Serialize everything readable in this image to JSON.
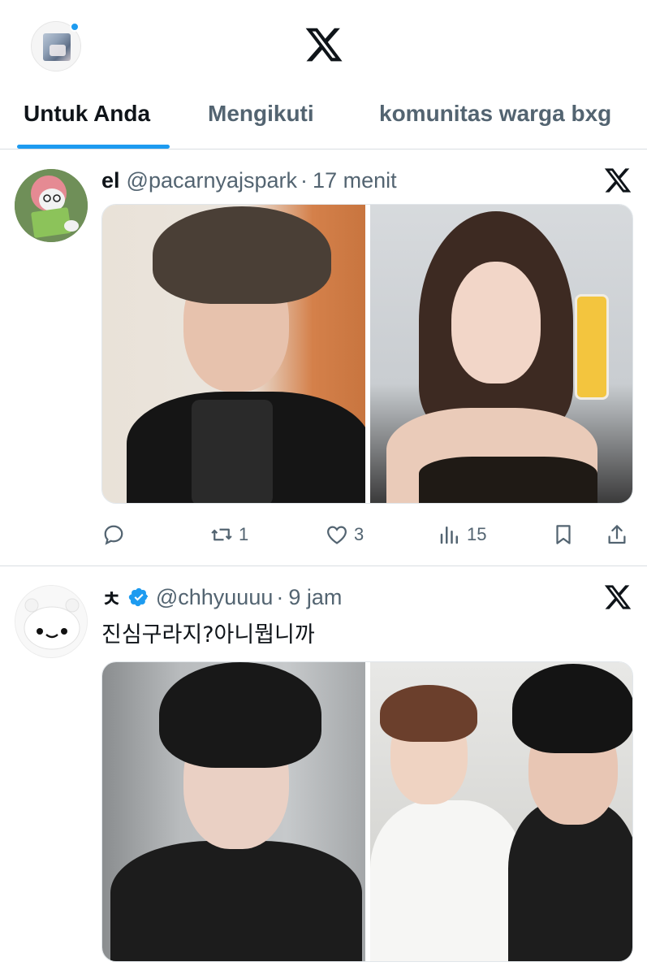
{
  "header": {
    "logo_icon": "x-logo-icon",
    "profile_icon": "profile-avatar",
    "notification_dot_color": "#1d9bf0"
  },
  "tabs": [
    {
      "label": "Untuk Anda",
      "active": true
    },
    {
      "label": "Mengikuti",
      "active": false
    },
    {
      "label": "komunitas warga bxg",
      "active": false
    }
  ],
  "accent_color": "#1d9bf0",
  "tweets": [
    {
      "name": "el",
      "handle": "@pacarnyajspark",
      "separator": "·",
      "time": "17 menit",
      "verified": false,
      "text": "",
      "media_count": 2,
      "actions": {
        "reply": "",
        "retweet": "1",
        "like": "3",
        "views": "15"
      }
    },
    {
      "name": "ㅊ",
      "handle": "@chhyuuuu",
      "separator": "·",
      "time": "9 jam",
      "verified": true,
      "text": "진심구라지?아니뭡니까",
      "media_count": 2
    }
  ]
}
